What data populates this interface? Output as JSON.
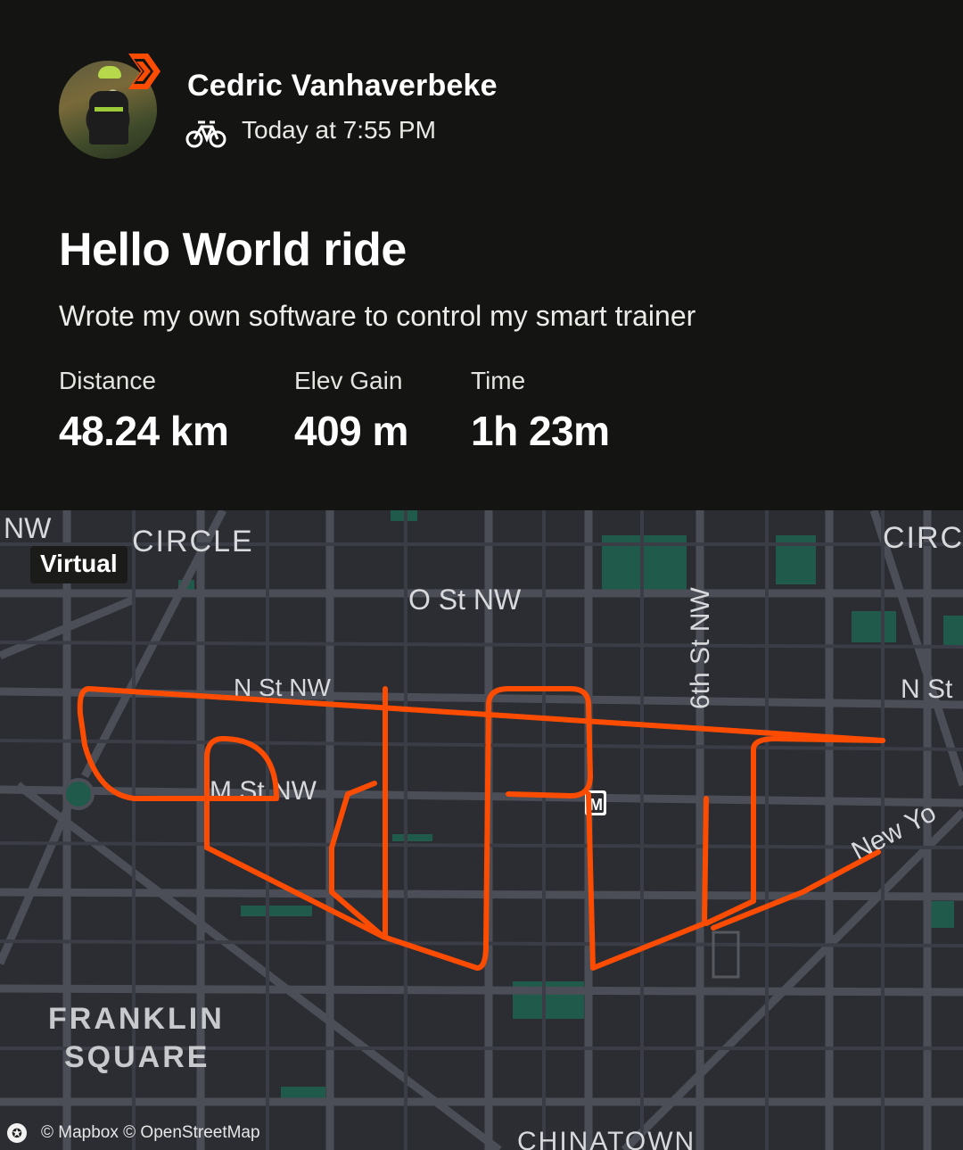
{
  "athlete": {
    "name": "Cedric Vanhaverbeke",
    "subscriber_badge_color": "#fc4c02"
  },
  "activity": {
    "sport_icon": "bike-icon",
    "timestamp": "Today at 7:55 PM",
    "title": "Hello World ride",
    "description": "Wrote my own software to control my smart trainer"
  },
  "stats": [
    {
      "label": "Distance",
      "value": "48.24 km"
    },
    {
      "label": "Elev Gain",
      "value": "409 m"
    },
    {
      "label": "Time",
      "value": "1h 23m"
    }
  ],
  "map": {
    "badge": "Virtual",
    "route_color": "#fc4c02",
    "labels": {
      "nw": "NW",
      "circle": "CIRCLE",
      "circle_right": "CIRC",
      "o_st": "O St NW",
      "n_st": "N St NW",
      "n_st_right": "N St",
      "m_st": "M St NW",
      "sixth_st": "6th St NW",
      "new_york": "New Yo",
      "metro": "M",
      "franklin": "FRANKLIN",
      "square": "SQUARE",
      "chinatown": "CHINATOWN"
    },
    "attribution": "© Mapbox © OpenStreetMap"
  },
  "colors": {
    "background": "#141412",
    "map_background": "#2b2d33",
    "park": "#1f5a4a",
    "street": "#4b4e57"
  }
}
